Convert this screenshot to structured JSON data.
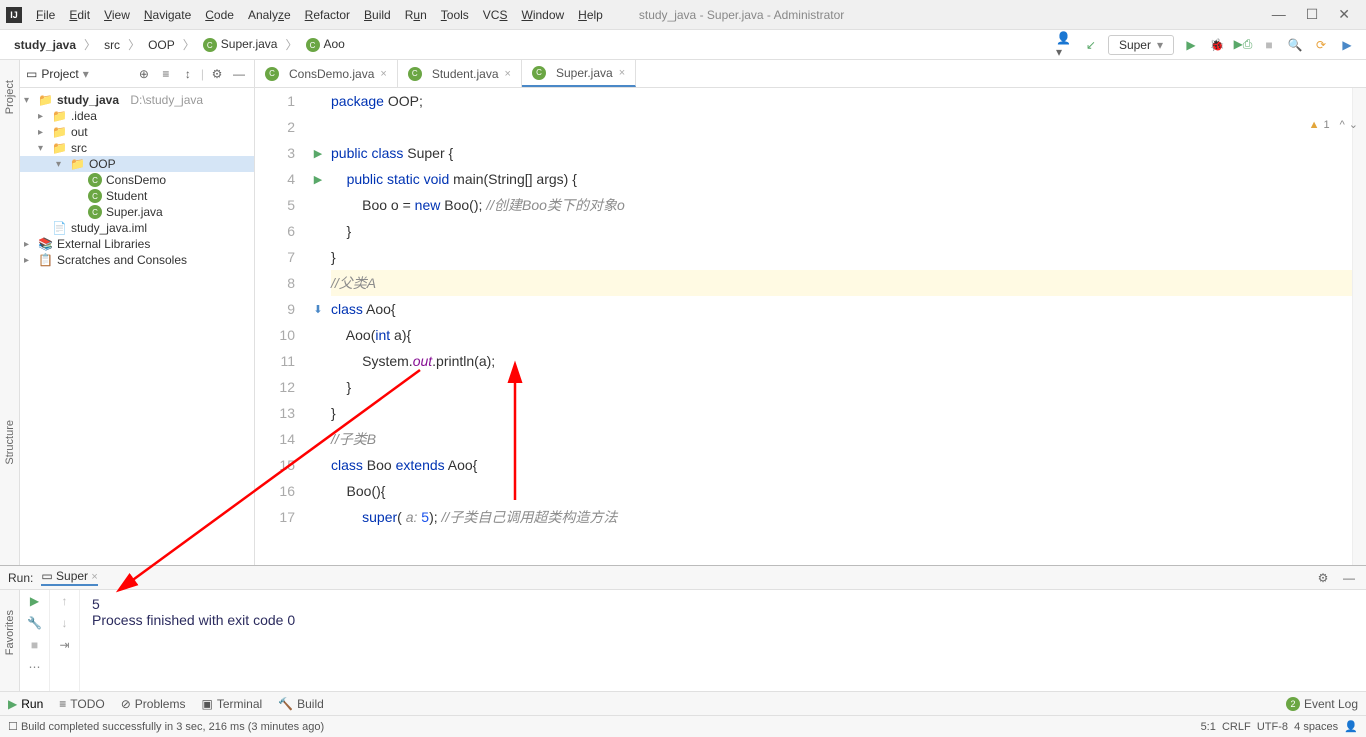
{
  "window": {
    "title": "study_java - Super.java - Administrator"
  },
  "menu": [
    "File",
    "Edit",
    "View",
    "Navigate",
    "Code",
    "Analyze",
    "Refactor",
    "Build",
    "Run",
    "Tools",
    "VCS",
    "Window",
    "Help"
  ],
  "breadcrumb": [
    "study_java",
    "src",
    "OOP",
    "Super.java",
    "Aoo"
  ],
  "run_config": "Super",
  "project_panel": {
    "title": "Project"
  },
  "tree": {
    "root": "study_java",
    "root_path": "D:\\study_java",
    "idea": ".idea",
    "out": "out",
    "src": "src",
    "oop": "OOP",
    "f1": "ConsDemo",
    "f2": "Student",
    "f3": "Super.java",
    "iml": "study_java.iml",
    "ext": "External Libraries",
    "scratch": "Scratches and Consoles"
  },
  "tabs": [
    {
      "label": "ConsDemo.java"
    },
    {
      "label": "Student.java"
    },
    {
      "label": "Super.java"
    }
  ],
  "code": {
    "l1": "package OOP;",
    "l2": "",
    "l3": "public class Super {",
    "l4": "    public static void main(String[] args) {",
    "l5p": "        Boo o = new Boo(); ",
    "l5c": "//创建Boo类下的对象o",
    "l6": "    }",
    "l7": "}",
    "l8": "//父类A",
    "l9": "class Aoo{",
    "l10": "    Aoo(int a){",
    "l11a": "        System.",
    "l11b": "out",
    "l11c": ".println(a);",
    "l12": "    }",
    "l13": "}",
    "l14": "//子类B",
    "l15": "class Boo extends Aoo{",
    "l16": "    Boo(){",
    "l17a": "        super( ",
    "l17p": "a: ",
    "l17b": "5); ",
    "l17c": "//子类自己调用超类构造方法"
  },
  "lines_start": 1,
  "lines_end": 17,
  "inspection": {
    "warn_count": "1"
  },
  "run": {
    "label": "Run:",
    "tab": "Super",
    "out1": "5",
    "out2": "",
    "out3": "Process finished with exit code 0"
  },
  "bottom": {
    "run": "Run",
    "todo": "TODO",
    "problems": "Problems",
    "terminal": "Terminal",
    "build": "Build",
    "eventlog": "Event Log",
    "event_count": "2"
  },
  "status": {
    "msg": "Build completed successfully in 3 sec, 216 ms (3 minutes ago)",
    "pos": "5:1",
    "le": "CRLF",
    "enc": "UTF-8",
    "indent": "4 spaces"
  },
  "side": {
    "project": "Project",
    "structure": "Structure",
    "favorites": "Favorites"
  }
}
